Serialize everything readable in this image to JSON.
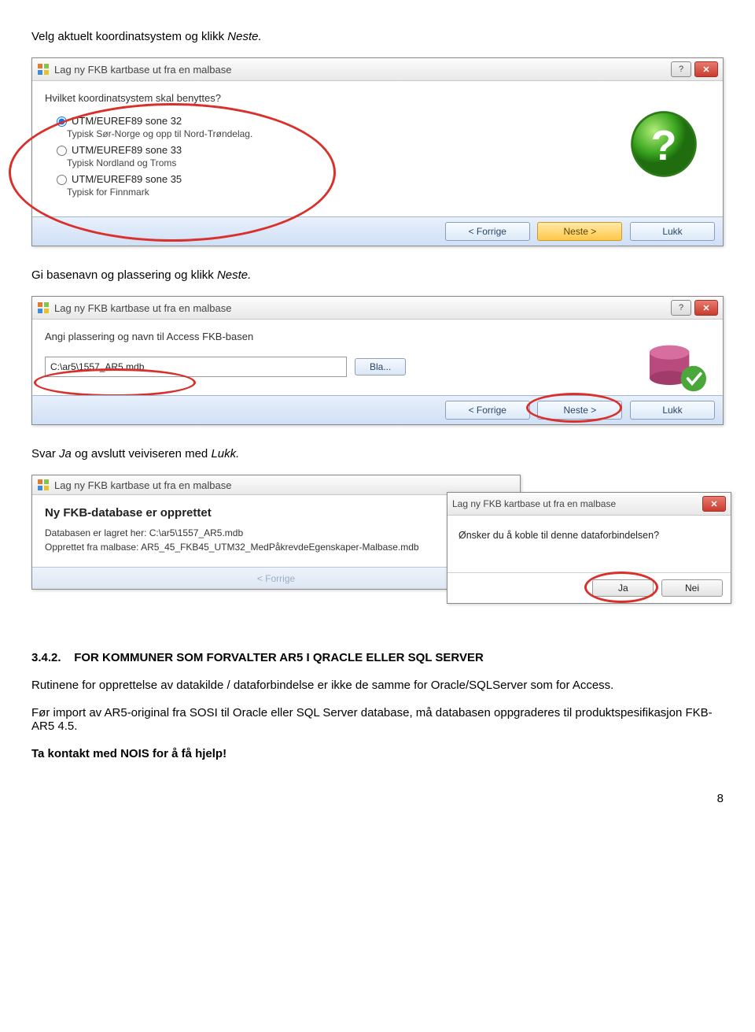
{
  "doc": {
    "line1a": "Velg aktuelt koordinatsystem og klikk ",
    "line1b": "Neste.",
    "line2a": "Gi basenavn og plassering og klikk ",
    "line2b": "Neste.",
    "line3a": "Svar ",
    "line3b": "Ja",
    "line3c": " og avslutt veiviseren med ",
    "line3d": "Lukk.",
    "heading_num": "3.4.2.",
    "heading_text": "FOR KOMMUNER SOM FORVALTER AR5 I QRACLE ELLER SQL SERVER",
    "para1": "Rutinene for opprettelse av datakilde / dataforbindelse er ikke de samme for Oracle/SQLServer som for Access.",
    "para2": "Før import av AR5-original fra SOSI til Oracle eller SQL Server database, må databasen oppgraderes til produktspesifikasjon FKB-AR5 4.5.",
    "para3": "Ta kontakt med NOIS for å få hjelp!",
    "page_num": "8"
  },
  "dialog1": {
    "title": "Lag ny FKB kartbase ut fra en malbase",
    "prompt": "Hvilket koordinatsystem skal benyttes?",
    "opts": [
      {
        "label": "UTM/EUREF89 sone 32",
        "sub": "Typisk Sør-Norge og opp til Nord-Trøndelag.",
        "checked": true
      },
      {
        "label": "UTM/EUREF89 sone 33",
        "sub": "Typisk Nordland og Troms",
        "checked": false
      },
      {
        "label": "UTM/EUREF89 sone 35",
        "sub": "Typisk for Finnmark",
        "checked": false
      }
    ],
    "prev": "< Forrige",
    "next": "Neste >",
    "close": "Lukk"
  },
  "dialog2": {
    "title": "Lag ny FKB kartbase ut fra en malbase",
    "prompt": "Angi plassering og navn til Access FKB-basen",
    "path": "C:\\ar5\\1557_AR5.mdb",
    "browse": "Bla...",
    "prev": "< Forrige",
    "next": "Neste >",
    "close": "Lukk"
  },
  "dialog3": {
    "title": "Lag ny FKB kartbase ut fra en malbase",
    "heading": "Ny FKB-database er opprettet",
    "line1": "Databasen er lagret her: C:\\ar5\\1557_AR5.mdb",
    "line2": "Opprettet fra malbase: AR5_45_FKB45_UTM32_MedPåkrevdeEgenskaper-Malbase.mdb",
    "prev_disabled": "< Forrige"
  },
  "dialog4": {
    "title": "Lag ny FKB kartbase ut fra en malbase",
    "prompt": "Ønsker du å koble til denne dataforbindelsen?",
    "yes": "Ja",
    "no": "Nei"
  }
}
